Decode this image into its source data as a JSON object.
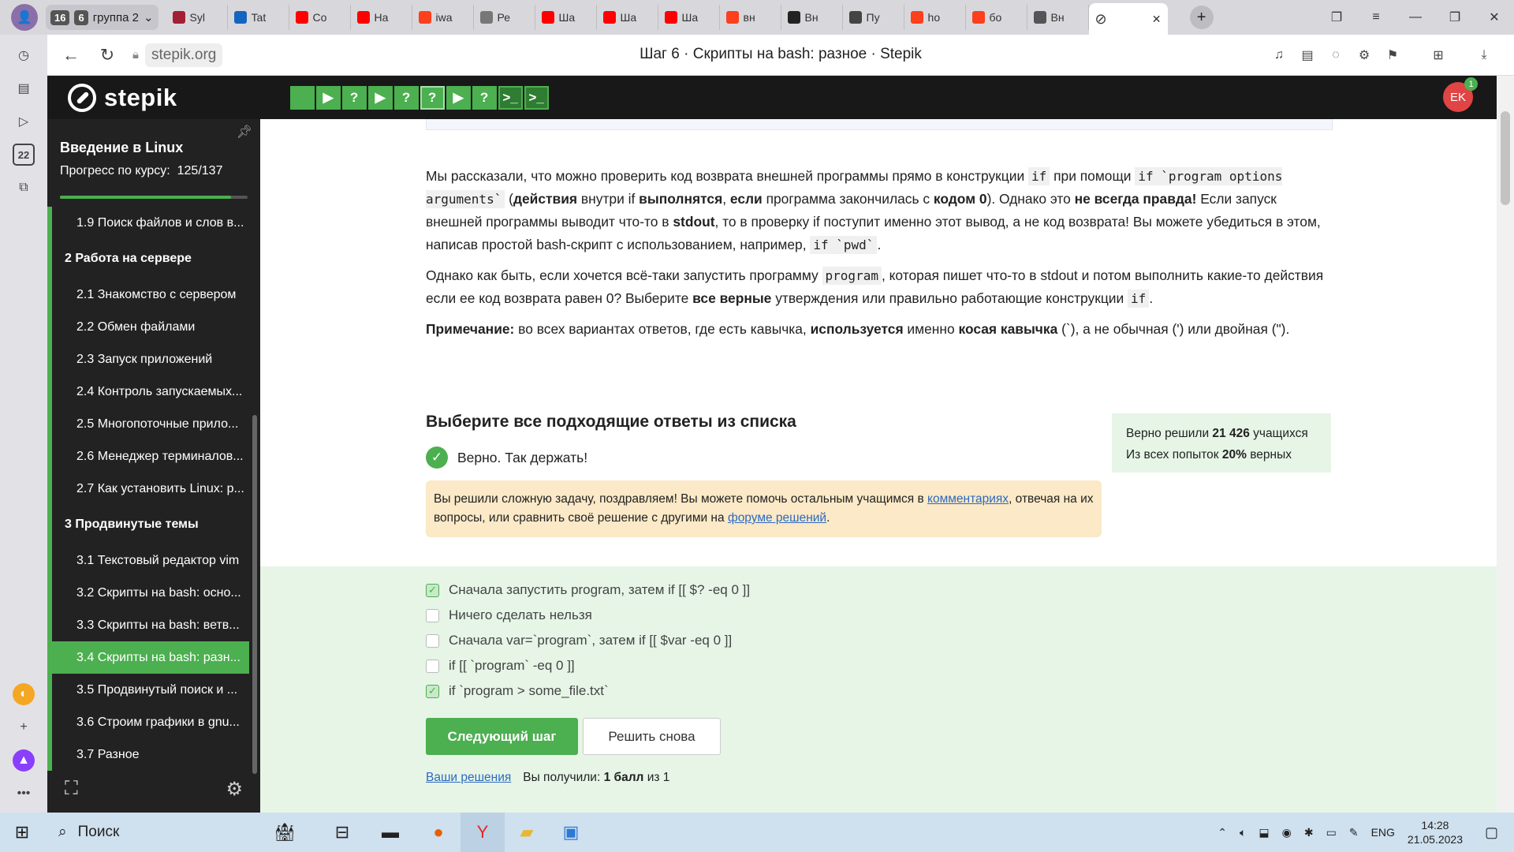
{
  "browser": {
    "profile_initial": "👤",
    "group": {
      "count": "16",
      "num": "6",
      "label": "группа 2"
    },
    "tabs": [
      {
        "label": "Syl",
        "color": "#a31f34"
      },
      {
        "label": "Tat",
        "color": "#1565c0"
      },
      {
        "label": "Co",
        "color": "#ff0000"
      },
      {
        "label": "На",
        "color": "#ff0000"
      },
      {
        "label": "iwa",
        "color": "#fc3f1d"
      },
      {
        "label": "Ре",
        "color": "#777777"
      },
      {
        "label": "Ша",
        "color": "#ff0000"
      },
      {
        "label": "Ша",
        "color": "#ff0000"
      },
      {
        "label": "Ша",
        "color": "#ff0000"
      },
      {
        "label": "вн",
        "color": "#fc3f1d"
      },
      {
        "label": "Вн",
        "color": "#222222"
      },
      {
        "label": "Пу",
        "color": "#444444"
      },
      {
        "label": "ho",
        "color": "#fc3f1d"
      },
      {
        "label": "бо",
        "color": "#fc3f1d"
      },
      {
        "label": "Вн",
        "color": "#555555"
      }
    ],
    "url": "stepik.org",
    "page_title": "Шаг 6 · Скрипты на bash: разное · Stepik",
    "side_badge": "22"
  },
  "header": {
    "logo_text": "stepik",
    "steps": [
      "",
      "▶",
      "?",
      "▶",
      "?",
      "?",
      "▶",
      "?",
      ">_",
      ">_"
    ],
    "avatar_initials": "EK",
    "avatar_badge": "1"
  },
  "course": {
    "title": "Введение в Linux",
    "progress_label": "Прогресс по курсу:",
    "progress_value": "125/137",
    "progress_fraction": 0.912,
    "items": [
      {
        "type": "lesson",
        "label": "1.9  Поиск файлов и слов в..."
      },
      {
        "type": "section",
        "label": "2  Работа на сервере"
      },
      {
        "type": "lesson",
        "label": "2.1  Знакомство с сервером"
      },
      {
        "type": "lesson",
        "label": "2.2  Обмен файлами"
      },
      {
        "type": "lesson",
        "label": "2.3  Запуск приложений"
      },
      {
        "type": "lesson",
        "label": "2.4  Контроль запускаемых..."
      },
      {
        "type": "lesson",
        "label": "2.5  Многопоточные прило..."
      },
      {
        "type": "lesson",
        "label": "2.6  Менеджер терминалов..."
      },
      {
        "type": "lesson",
        "label": "2.7  Как установить Linux: р..."
      },
      {
        "type": "section",
        "label": "3  Продвинутые темы"
      },
      {
        "type": "lesson",
        "label": "3.1  Текстовый редактор vim"
      },
      {
        "type": "lesson",
        "label": "3.2  Скрипты на bash: осно..."
      },
      {
        "type": "lesson",
        "label": "3.3  Скрипты на bash: ветв..."
      },
      {
        "type": "lesson",
        "label": "3.4  Скрипты на bash: разн...",
        "active": true
      },
      {
        "type": "lesson",
        "label": "3.5  Продвинутый поиск и ..."
      },
      {
        "type": "lesson",
        "label": "3.6  Строим графики в gnu..."
      },
      {
        "type": "lesson",
        "label": "3.7  Разное"
      }
    ]
  },
  "body": {
    "p1": {
      "a": "Мы рассказали, что можно проверить код возврата внешней программы прямо в конструкции ",
      "code1": "if",
      "b": " при помощи ",
      "code2": "if `program options arguments`",
      "c": " (",
      "bold1": "действия",
      "d": " внутри if ",
      "bold2": "выполнятся",
      "e": ", ",
      "bold3": "если",
      "f": " программа закончилась с ",
      "bold4": "кодом 0",
      "g": "). Однако это ",
      "bold5": "не всегда правда!",
      "h": " Если запуск внешней программы выводит что-то в ",
      "bold6": "stdout",
      "i": ", то в проверку if поступит именно этот вывод, а не код возврата! Вы можете убедиться в этом, написав простой bash-скрипт с использованием, например, ",
      "code3": "if `pwd`",
      "j": "."
    },
    "p2": {
      "a": "Однако как быть, если хочется всё-таки запустить программу ",
      "code1": "program",
      "b": ", которая пишет что-то в stdout и потом выполнить какие-то действия если ее код возврата равен 0? Выберите ",
      "bold1": "все верные",
      "c": " утверждения или правильно работающие конструкции ",
      "code2": "if",
      "d": "."
    },
    "p3": {
      "bold1": "Примечание:",
      "a": " во всех вариантах ответов, где есть кавычка, ",
      "bold2": "используется",
      "b": " именно ",
      "bold3": "косая кавычка",
      "c": " (`), а не обычная (') или двойная (\")."
    }
  },
  "quiz": {
    "title": "Выберите все подходящие ответы из списка",
    "correct_text": "Верно. Так держать!",
    "stats_line1_pre": "Верно решили ",
    "stats_line1_bold": "21 426",
    "stats_line1_post": " учащихся",
    "stats_line2_pre": "Из всех попыток ",
    "stats_line2_bold": "20%",
    "stats_line2_post": " верных",
    "hint_a": "Вы решили сложную задачу, поздравляем! Вы можете помочь остальным учащимся в ",
    "hint_link1": "комментариях",
    "hint_b": ", отвечая на их вопросы, или сравнить своё решение с другими на ",
    "hint_link2": "форуме решений",
    "hint_c": ".",
    "options": [
      {
        "label": "Сначала запустить program, затем if [[ $? -eq 0 ]]",
        "checked": true
      },
      {
        "label": "Ничего сделать нельзя",
        "checked": false
      },
      {
        "label": "Сначала var=`program`, затем if [[ $var -eq 0 ]]",
        "checked": false
      },
      {
        "label": "if [[ `program` -eq 0 ]]",
        "checked": false
      },
      {
        "label": "if `program > some_file.txt`",
        "checked": true
      }
    ],
    "next_label": "Следующий шаг",
    "again_label": "Решить снова",
    "solutions_link": "Ваши решения",
    "score_pre": "Вы получили: ",
    "score_bold": "1 балл",
    "score_post": " из 1"
  },
  "taskbar": {
    "search_label": "Поиск",
    "lang": "ENG",
    "time": "14:28",
    "date": "21.05.2023"
  }
}
